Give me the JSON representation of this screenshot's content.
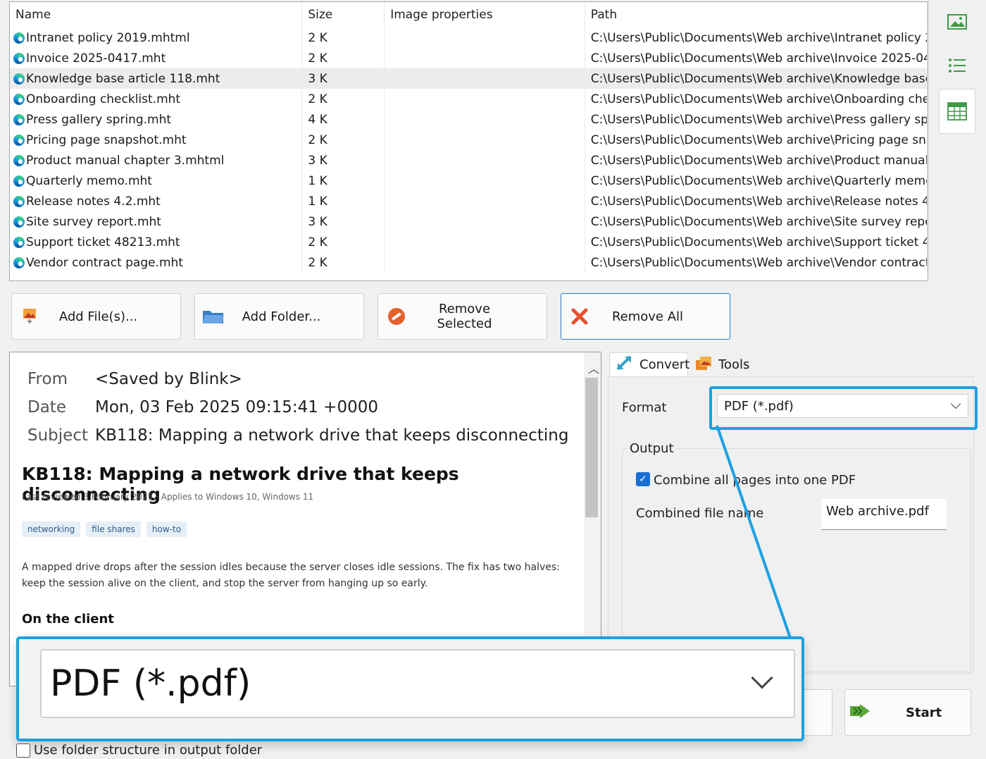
{
  "file_list": {
    "columns": [
      "Name",
      "Size",
      "Image properties",
      "Path"
    ],
    "rows": [
      {
        "name": "Intranet policy 2019.mhtml",
        "size": "2 K",
        "props": "",
        "path": "C:\\Users\\Public\\Documents\\Web archive\\Intranet policy 2..."
      },
      {
        "name": "Invoice 2025-0417.mht",
        "size": "2 K",
        "props": "",
        "path": "C:\\Users\\Public\\Documents\\Web archive\\Invoice 2025-04..."
      },
      {
        "name": "Knowledge base article 118.mht",
        "size": "3 K",
        "props": "",
        "path": "C:\\Users\\Public\\Documents\\Web archive\\Knowledge base..."
      },
      {
        "name": "Onboarding checklist.mht",
        "size": "2 K",
        "props": "",
        "path": "C:\\Users\\Public\\Documents\\Web archive\\Onboarding che..."
      },
      {
        "name": "Press gallery spring.mht",
        "size": "4 K",
        "props": "",
        "path": "C:\\Users\\Public\\Documents\\Web archive\\Press gallery spri..."
      },
      {
        "name": "Pricing page snapshot.mht",
        "size": "2 K",
        "props": "",
        "path": "C:\\Users\\Public\\Documents\\Web archive\\Pricing page sna..."
      },
      {
        "name": "Product manual chapter 3.mhtml",
        "size": "3 K",
        "props": "",
        "path": "C:\\Users\\Public\\Documents\\Web archive\\Product manual ..."
      },
      {
        "name": "Quarterly memo.mht",
        "size": "1 K",
        "props": "",
        "path": "C:\\Users\\Public\\Documents\\Web archive\\Quarterly memo..."
      },
      {
        "name": "Release notes 4.2.mht",
        "size": "1 K",
        "props": "",
        "path": "C:\\Users\\Public\\Documents\\Web archive\\Release notes 4...."
      },
      {
        "name": "Site survey report.mht",
        "size": "3 K",
        "props": "",
        "path": "C:\\Users\\Public\\Documents\\Web archive\\Site survey repo..."
      },
      {
        "name": "Support ticket 48213.mht",
        "size": "2 K",
        "props": "",
        "path": "C:\\Users\\Public\\Documents\\Web archive\\Support ticket 4..."
      },
      {
        "name": "Vendor contract page.mht",
        "size": "2 K",
        "props": "",
        "path": "C:\\Users\\Public\\Documents\\Web archive\\Vendor contract ..."
      }
    ],
    "selected_index": 2
  },
  "buttons": {
    "add_files": "Add File(s)...",
    "add_folder": "Add Folder...",
    "remove_selected": "Remove Selected",
    "remove_all": "Remove All",
    "start": "Start"
  },
  "preview": {
    "from_key": "From",
    "from_val": "<Saved by Blink>",
    "date_key": "Date",
    "date_val": "Mon, 03 Feb 2025 09:15:41 +0000",
    "subject_key": "Subject",
    "subject_val": "KB118: Mapping a network drive that keeps disconnecting",
    "title": "KB118: Mapping a network drive that keeps disconnecting",
    "meta": "Last reviewed 3 February 2025 · Applies to Windows 10, Windows 11",
    "tags": [
      "networking",
      "file shares",
      "how-to"
    ],
    "body": "A mapped drive drops after the session idles because the server closes idle sessions. The fix has two halves: keep the session alive on the client, and stop the server from hanging up so early.",
    "section_heading": "On the client"
  },
  "tabs": {
    "convert": "Convert",
    "tools": "Tools"
  },
  "convert": {
    "format_label": "Format",
    "format_value": "PDF (*.pdf)",
    "output_label": "Output",
    "combine_label": "Combine all pages into one PDF",
    "combine_checked": true,
    "combined_name_label": "Combined file name",
    "combined_name_value": "Web archive.pdf"
  },
  "zoom_callout": {
    "value": "PDF (*.pdf)"
  },
  "folder_structure_label": "Use folder structure in output folder",
  "colors": {
    "highlight": "#1ba1e2",
    "checkbox": "#1a6fd1"
  }
}
